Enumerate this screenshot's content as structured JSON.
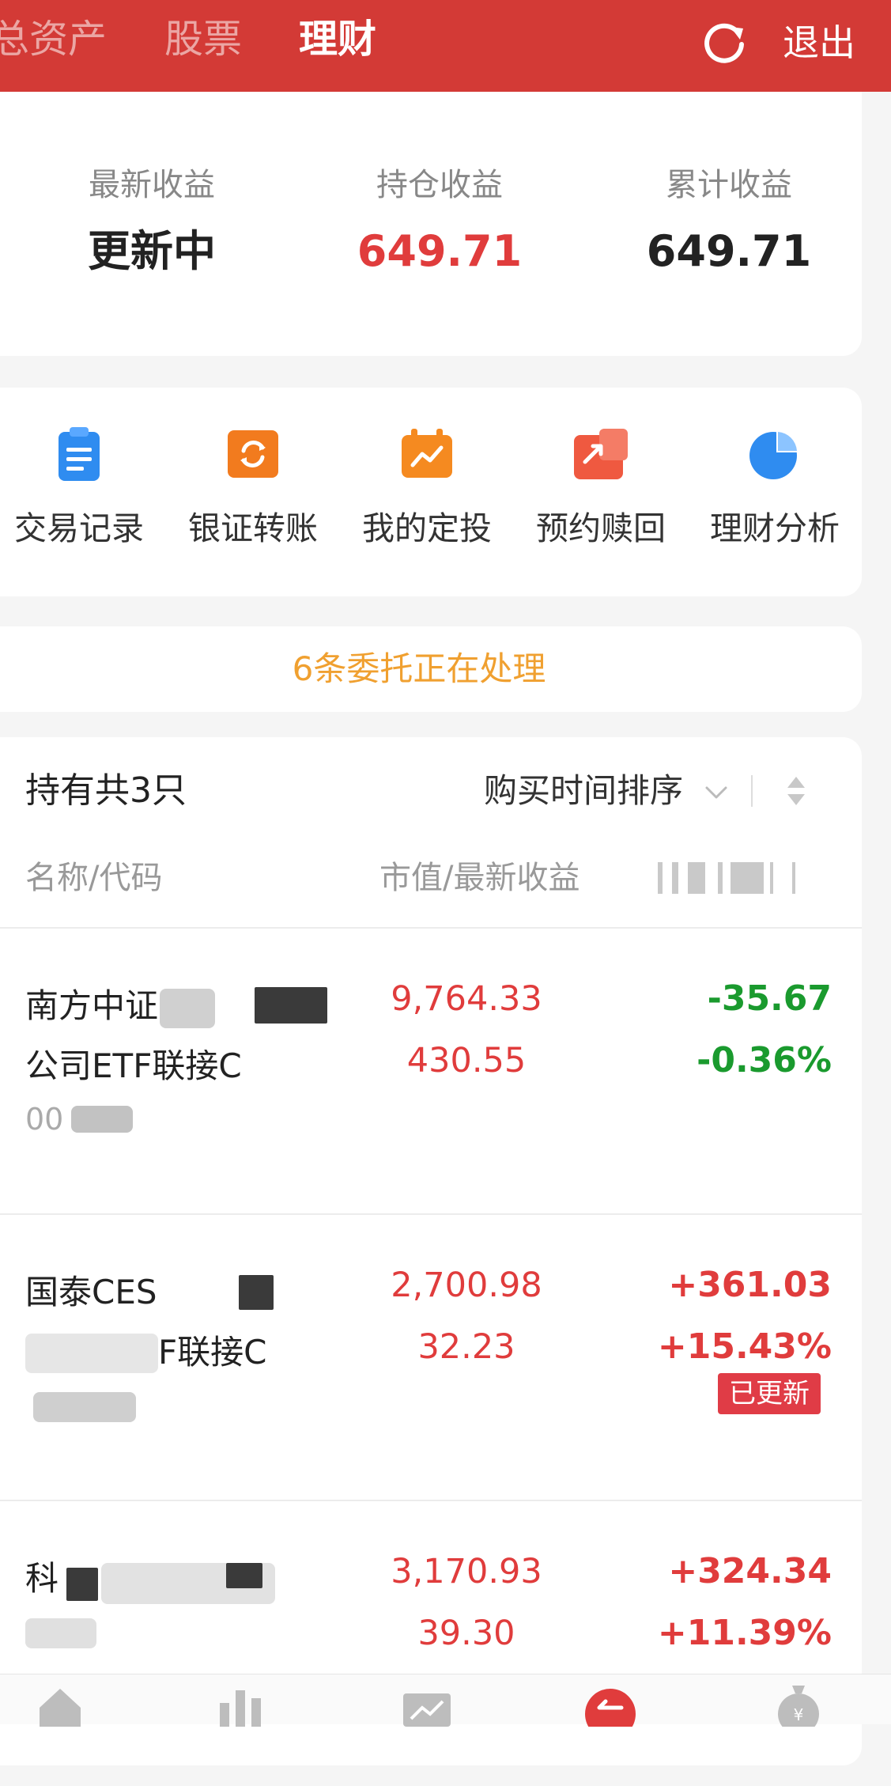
{
  "header": {
    "tabs": [
      {
        "label": "总资产",
        "active": false
      },
      {
        "label": "股票",
        "active": false
      },
      {
        "label": "理财",
        "active": true
      }
    ],
    "refresh_icon": "refresh-icon",
    "exit_label": "退出"
  },
  "earnings": {
    "latest": {
      "label": "最新收益",
      "value": "更新中"
    },
    "holding": {
      "label": "持仓收益",
      "value": "649.71"
    },
    "cumulative": {
      "label": "累计收益",
      "value": "649.71"
    }
  },
  "shortcuts": [
    {
      "label": "交易记录",
      "icon": "clipboard-icon",
      "color": "#2f8cf0"
    },
    {
      "label": "银证转账",
      "icon": "transfer-icon",
      "color": "#f27b1e"
    },
    {
      "label": "我的定投",
      "icon": "calendar-chart-icon",
      "color": "#f58a20"
    },
    {
      "label": "预约赎回",
      "icon": "redeem-icon",
      "color": "#ef5940"
    },
    {
      "label": "理财分析",
      "icon": "pie-chart-icon",
      "color": "#2f8cf0"
    }
  ],
  "notice": {
    "text": "6条委托正在处理"
  },
  "holdings": {
    "title": "持有共3只",
    "sort_label": "购买时间排序",
    "columns": {
      "name": "名称/代码",
      "value": "市值/最新收益"
    },
    "funds": [
      {
        "name_line1": "南方中证",
        "name_line2": "公司ETF联接C",
        "code": "00",
        "market_value": "9,764.33",
        "latest_income": "430.55",
        "change_amount": "-35.67",
        "change_pct": "-0.36%",
        "direction": "down",
        "badge": ""
      },
      {
        "name_line1": "国泰CES",
        "name_line2": "F联接C",
        "code": "",
        "market_value": "2,700.98",
        "latest_income": "32.23",
        "change_amount": "+361.03",
        "change_pct": "+15.43%",
        "direction": "up",
        "badge": "已更新"
      },
      {
        "name_line1": "科",
        "name_line2": "",
        "code": "",
        "market_value": "3,170.93",
        "latest_income": "39.30",
        "change_amount": "+324.34",
        "change_pct": "+11.39%",
        "direction": "up",
        "badge": ""
      }
    ]
  },
  "colors": {
    "header_red": "#d33a36",
    "up_red": "#e03c3c",
    "down_green": "#1a9a2e",
    "notice_orange": "#f0a030"
  }
}
